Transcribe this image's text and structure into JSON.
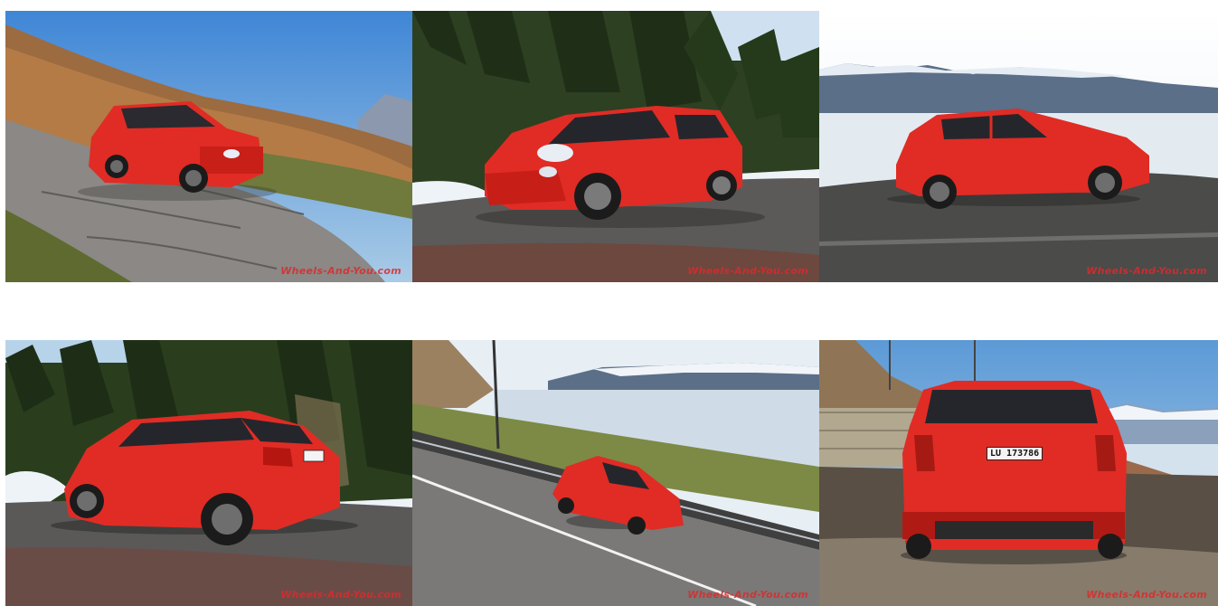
{
  "gallery": {
    "watermark": "Wheels-And-You.com",
    "items": [
      {
        "id": 1,
        "subject": "red-car-front-three-quarter-forest-road"
      },
      {
        "id": 2,
        "subject": "red-car-front-three-quarter-pine-forest"
      },
      {
        "id": 3,
        "subject": "red-car-side-lake-view"
      },
      {
        "id": 4,
        "subject": "red-car-rear-three-quarter-forest"
      },
      {
        "id": 5,
        "subject": "red-car-aerial-lakeside-road"
      },
      {
        "id": 6,
        "subject": "red-car-rear-view-lake"
      }
    ],
    "license_plate": "LU 173786"
  },
  "colors": {
    "car_red": "#e02c25",
    "car_dark": "#a31812",
    "sky": "#7fb1e0",
    "forest": "#2f4a24",
    "road": "#6f6d6a",
    "lake": "#dfe8ef",
    "mountain": "#5b6f88",
    "watermark": "#e0282b"
  }
}
